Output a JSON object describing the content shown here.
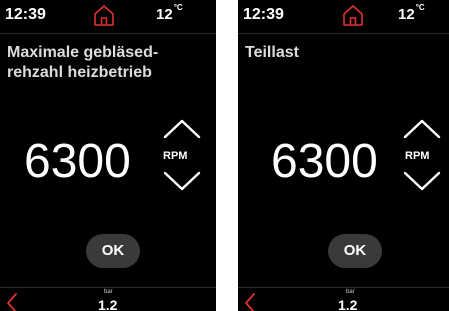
{
  "colors": {
    "accent_red": "#e0302f",
    "background": "#000000",
    "button": "#3a3a3a"
  },
  "screens": [
    {
      "time": "12:39",
      "temperature": "12",
      "temperature_unit": "°C",
      "title": "Maximale gebläsed-rehzahl heizbetrieb",
      "value": "6300",
      "unit": "RPM",
      "ok_label": "OK",
      "pressure_unit": "bar",
      "pressure_value": "1.2",
      "icons": [
        "home-icon",
        "chevron-up-icon",
        "chevron-down-icon",
        "back-icon"
      ]
    },
    {
      "time": "12:39",
      "temperature": "12",
      "temperature_unit": "°C",
      "title": "Teillast",
      "value": "6300",
      "unit": "RPM",
      "ok_label": "OK",
      "pressure_unit": "bar",
      "pressure_value": "1.2",
      "icons": [
        "home-icon",
        "chevron-up-icon",
        "chevron-down-icon",
        "back-icon"
      ]
    }
  ]
}
